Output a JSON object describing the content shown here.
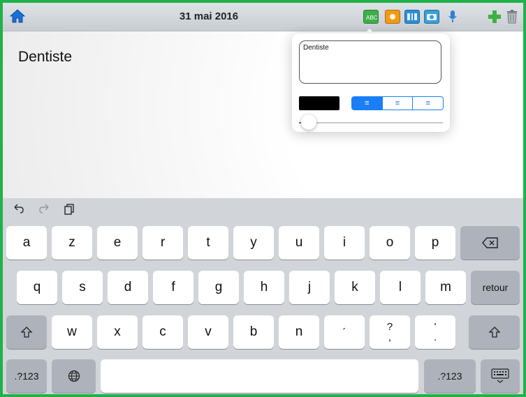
{
  "topbar": {
    "date": "31 mai 2016",
    "icons": [
      {
        "name": "home-icon",
        "color": "#1a6fd8"
      },
      {
        "name": "text-tool-icon",
        "color": "#3fae4a"
      },
      {
        "name": "photo-icon",
        "color": "#f09a1c"
      },
      {
        "name": "video-icon",
        "color": "#2c8fd6"
      },
      {
        "name": "camera-icon",
        "color": "#3a9fd8"
      },
      {
        "name": "microphone-icon",
        "color": "#2f7fd0"
      },
      {
        "name": "add-icon",
        "color": "#3cb043"
      },
      {
        "name": "trash-icon",
        "color": "#8a8f95"
      }
    ]
  },
  "page": {
    "text": "Dentiste"
  },
  "popover": {
    "text_value": "Dentiste",
    "color_swatch": "#000000",
    "alignment_options": [
      "align-left",
      "align-center",
      "align-right"
    ],
    "selected_alignment": "align-left",
    "font_size_level": 0.07
  },
  "keyboard": {
    "toolbar": [
      "undo-icon",
      "redo-icon",
      "paste-icon"
    ],
    "row1": [
      "a",
      "z",
      "e",
      "r",
      "t",
      "y",
      "u",
      "i",
      "o",
      "p"
    ],
    "row2": [
      "q",
      "s",
      "d",
      "f",
      "g",
      "h",
      "j",
      "k",
      "l",
      "m"
    ],
    "row3": [
      "w",
      "x",
      "c",
      "v",
      "b",
      "n"
    ],
    "row3_punct": [
      [
        "´",
        ""
      ],
      [
        "?",
        ","
      ],
      [
        "'",
        "."
      ]
    ],
    "return_label": "retour",
    "numbers_label": ".?123",
    "accent_color": "#1a7ef7"
  }
}
